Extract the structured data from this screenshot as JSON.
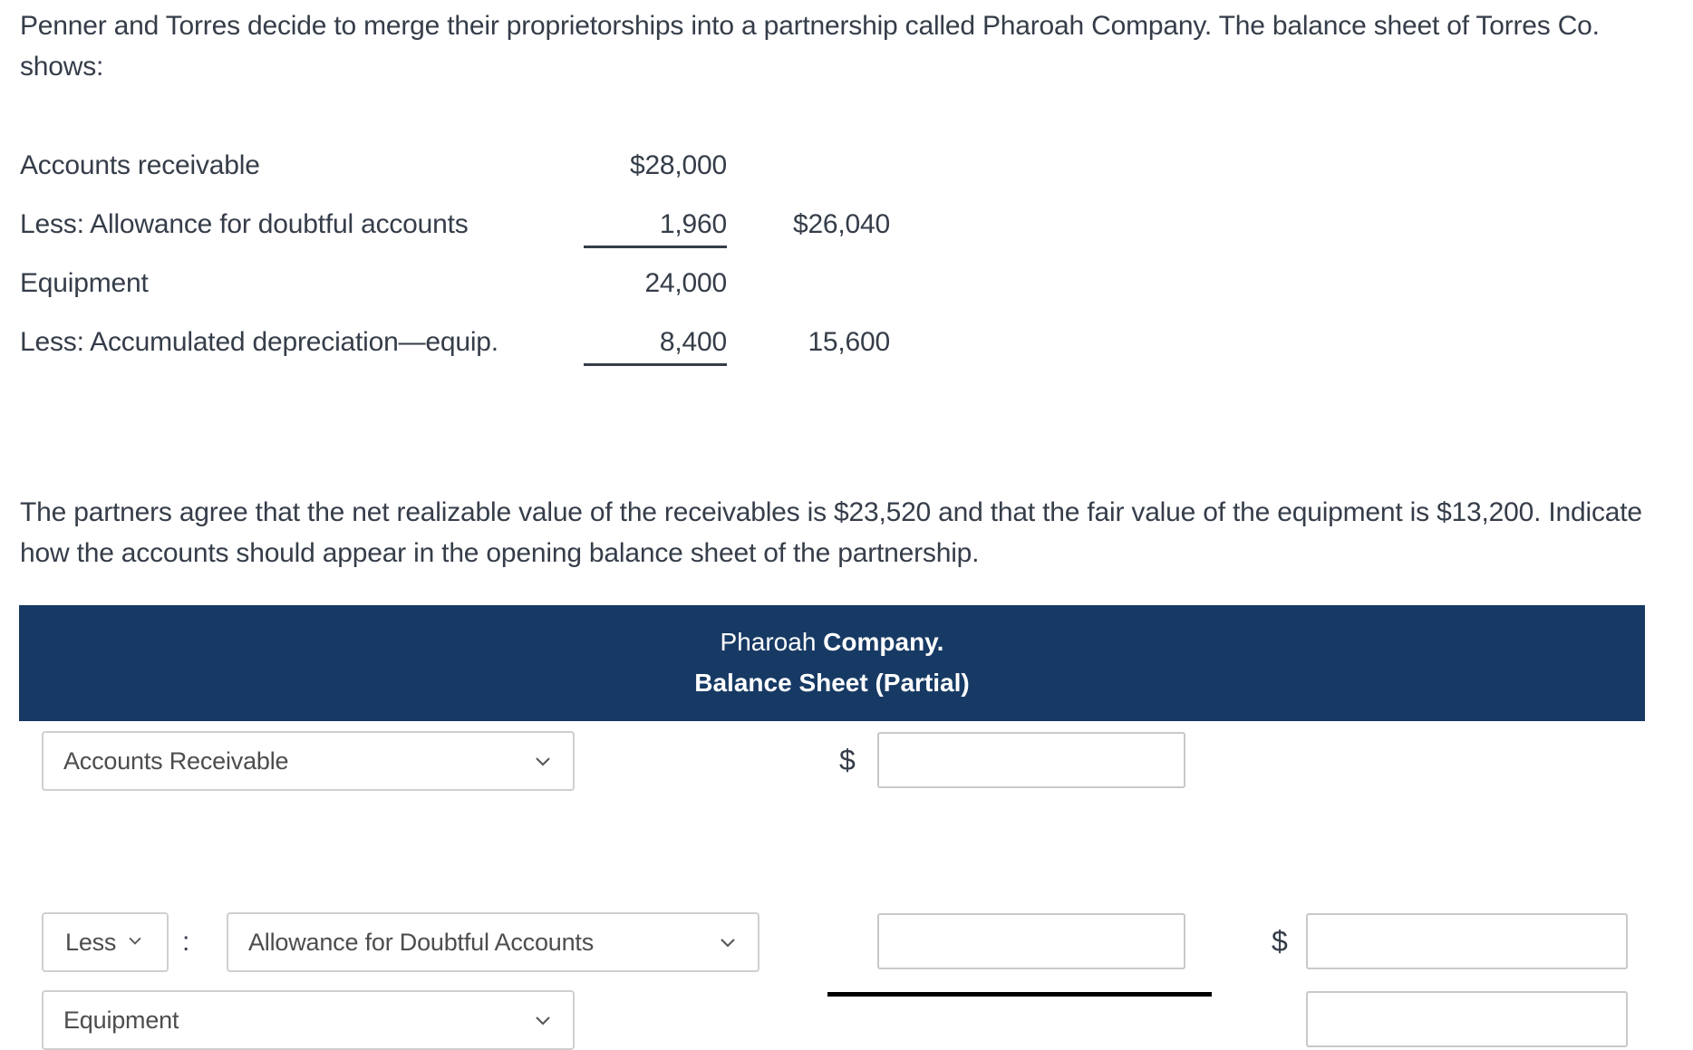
{
  "problem": {
    "intro_paragraph": "Penner and Torres decide to merge their proprietorships into a partnership called Pharoah Company. The balance sheet of Torres Co. shows:",
    "agreement_paragraph": "The partners agree that the net realizable value of the receivables is $23,520 and that the fair value of the equipment is $13,200. Indicate how the accounts should appear in the opening balance sheet of the partnership."
  },
  "torres_balance_sheet": {
    "rows": [
      {
        "label": "Accounts receivable",
        "col1": "$28,000",
        "col2": "",
        "col1_ruled": false
      },
      {
        "label": "Less: Allowance for doubtful accounts",
        "col1": "1,960",
        "col2": "$26,040",
        "col1_ruled": true
      },
      {
        "label": "Equipment",
        "col1": "24,000",
        "col2": "",
        "col1_ruled": false
      },
      {
        "label": "Less: Accumulated depreciation—equip.",
        "col1": "8,400",
        "col2": "15,600",
        "col1_ruled": true
      }
    ]
  },
  "answer_sheet": {
    "header": {
      "company_name": "Pharoah ",
      "company_suffix": "Company.",
      "subtitle": "Balance Sheet (Partial)",
      "background_color": "#173a64",
      "text_color": "#ffffff"
    },
    "rows": [
      {
        "account_select_value": "Accounts Receivable",
        "dollar_sign_col1": "$",
        "amount_col1": "",
        "amount_col1_placeholder": "",
        "dollar_sign_col2": "",
        "amount_col2": "",
        "amount_col2_placeholder": ""
      },
      {
        "modifier_select_value": "Less",
        "colon": ":",
        "account_select_value": "Allowance for Doubtful Accounts",
        "dollar_sign_col1": "",
        "amount_col1": "",
        "amount_col1_placeholder": "",
        "dollar_sign_col2": "$",
        "amount_col2": "",
        "amount_col2_placeholder": ""
      },
      {
        "account_select_value": "Equipment",
        "dollar_sign_col1": "",
        "amount_col1": "",
        "amount_col1_placeholder": "",
        "dollar_sign_col2": "",
        "amount_col2": "",
        "amount_col2_placeholder": ""
      }
    ]
  }
}
